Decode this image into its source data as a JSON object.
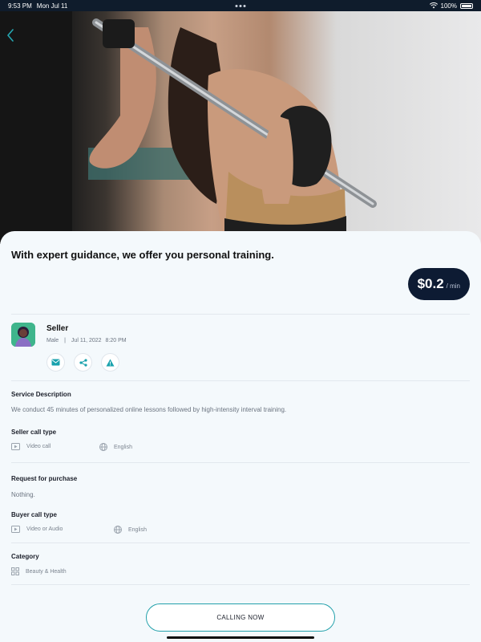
{
  "status_bar": {
    "time": "9:53 PM",
    "date": "Mon Jul 11",
    "battery": "100%"
  },
  "listing": {
    "title": "With expert guidance, we offer you personal training.",
    "price": "$0.2",
    "price_unit": "/ min"
  },
  "seller": {
    "name": "Seller",
    "gender": "Male",
    "date": "Jul 11, 2022",
    "time": "8:20 PM"
  },
  "service": {
    "label": "Service Description",
    "text": "We conduct 45 minutes of personalized online lessons followed by high-intensity interval training."
  },
  "seller_call": {
    "label": "Seller call type",
    "type": "Video call",
    "language": "English"
  },
  "request": {
    "label": "Request for purchase",
    "text": "Nothing."
  },
  "buyer_call": {
    "label": "Buyer call type",
    "type": "Video or Audio",
    "language": "English"
  },
  "category": {
    "label": "Category",
    "value": "Beauty & Health"
  },
  "cta": {
    "label": "CALLING NOW"
  },
  "icons": [
    "back-icon",
    "mail-icon",
    "share-icon",
    "warning-icon",
    "video-icon",
    "globe-icon",
    "category-icon",
    "wifi-icon",
    "battery-icon"
  ],
  "colors": {
    "accent": "#25a7b2",
    "price_bg": "#0d1b33",
    "avatar_bg": "#3fb58c"
  }
}
